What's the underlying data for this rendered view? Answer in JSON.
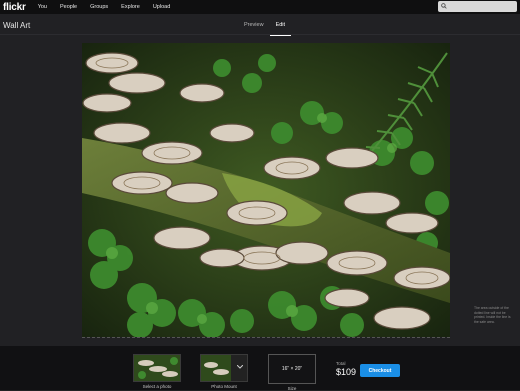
{
  "brand": {
    "logo": "flickr"
  },
  "nav": {
    "items": [
      "You",
      "People",
      "Groups",
      "Explore",
      "Upload"
    ]
  },
  "search": {
    "placeholder": ""
  },
  "page": {
    "title": "Wall Art"
  },
  "tabs": [
    {
      "label": "Preview",
      "active": false
    },
    {
      "label": "Edit",
      "active": true
    }
  ],
  "photo": {
    "subject": "turkey tail fungi on mossy log with clover and ferns"
  },
  "side_note": {
    "text": "The area outside of the dotted line will not be printed. Inside the line is the safe area."
  },
  "bottom": {
    "select_photo_label": "Select a photo",
    "mount_label": "Photo Mount",
    "size_value": "16\" × 20\"",
    "size_label": "Size",
    "total_label": "Total",
    "total_price": "$109",
    "checkout_label": "Checkout"
  },
  "colors": {
    "accent": "#1a8ee6",
    "background": "#212124",
    "topbar": "#0f0f10"
  }
}
